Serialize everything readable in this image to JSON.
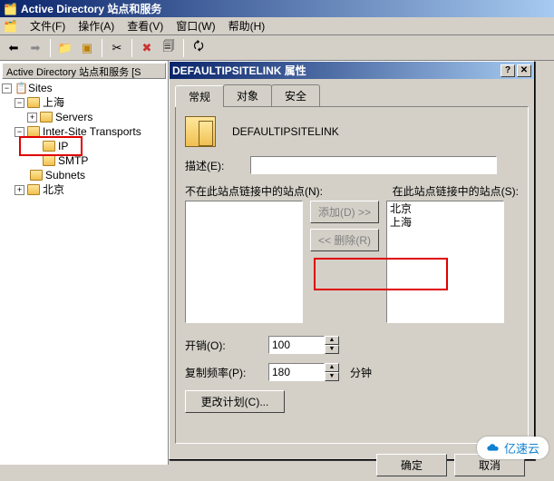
{
  "window": {
    "title": "Active Directory 站点和服务"
  },
  "menu": {
    "file": "文件(F)",
    "action": "操作(A)",
    "view": "查看(V)",
    "window": "窗口(W)",
    "help": "帮助(H)"
  },
  "tree": {
    "header": "Active Directory 站点和服务 [S",
    "root": "Sites",
    "shanghai": "上海",
    "servers": "Servers",
    "ist": "Inter-Site Transports",
    "ip": "IP",
    "smtp": "SMTP",
    "subnets": "Subnets",
    "beijing": "北京"
  },
  "dialog": {
    "title": "DEFAULTIPSITELINK 属性",
    "tabs": {
      "general": "常规",
      "object": "对象",
      "security": "安全"
    },
    "heading": "DEFAULTIPSITELINK",
    "desc_label": "描述(E):",
    "desc_value": "",
    "not_in_label": "不在此站点链接中的站点(N):",
    "in_label": "在此站点链接中的站点(S):",
    "in_sites": {
      "a": "北京",
      "b": "上海"
    },
    "add_btn": "添加(D) >>",
    "remove_btn": "<< 删除(R)",
    "cost_label": "开销(O):",
    "cost_value": "100",
    "repl_label": "复制频率(P):",
    "repl_value": "180",
    "repl_unit": "分钟",
    "schedule_btn": "更改计划(C)...",
    "ok": "确定",
    "cancel": "取消"
  },
  "watermark": "亿速云"
}
